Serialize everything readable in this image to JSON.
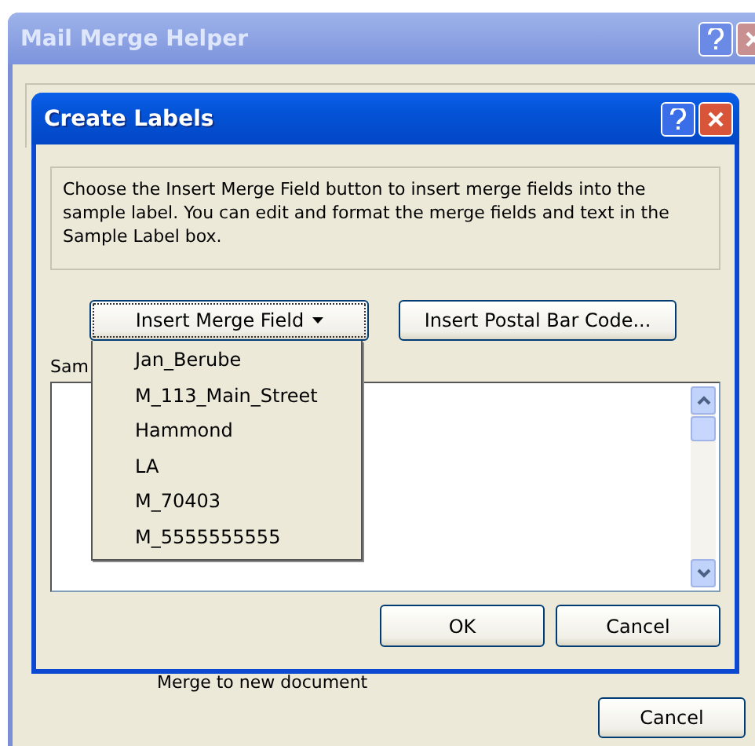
{
  "outer_window": {
    "title": "Mail Merge Helper",
    "active": false,
    "merge_option": "Merge to new document",
    "buttons": [
      "Cancel"
    ]
  },
  "dialog": {
    "title": "Create Labels",
    "active": true,
    "instructions": "Choose the Insert Merge Field button to insert merge fields into the sample label.  You can edit and format the merge fields and text in the Sample Label box.",
    "buttons": [
      {
        "label": "Insert Merge Field",
        "kind": "dropdown",
        "focused": true
      },
      {
        "label": "Insert Postal Bar Code...",
        "kind": "plain"
      }
    ],
    "sample_label": {
      "label": "Sam"
    },
    "menu": {
      "items": [
        "Jan_Berube",
        "M_113_Main_Street",
        "Hammond",
        "LA",
        "M_70403",
        "M_5555555555"
      ]
    },
    "footer_buttons": [
      "OK",
      "Cancel"
    ]
  }
}
